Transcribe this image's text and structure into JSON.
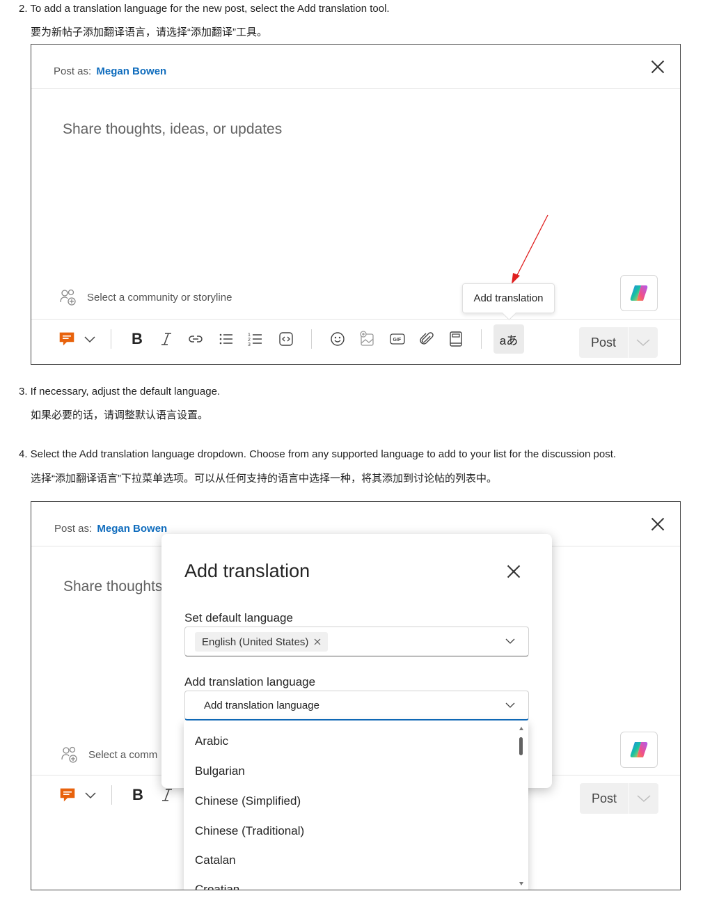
{
  "steps": [
    {
      "en": "2. To add a translation language for the new post, select the Add translation tool.",
      "cn": "要为新帖子添加翻译语言，请选择“添加翻译”工具。"
    },
    {
      "en": "3. If necessary, adjust the default language.",
      "cn": "如果必要的话，请调整默认语言设置。"
    },
    {
      "en": "4. Select the Add translation language dropdown. Choose from any supported language to add to your list for the discussion post.",
      "cn": "选择“添加翻译语言”下拉菜单选项。可以从任何支持的语言中选择一种，将其添加到讨论帖的列表中。"
    }
  ],
  "composer": {
    "post_as_label": "Post as:",
    "post_as_name": "Megan Bowen",
    "placeholder": "Share thoughts, ideas, or updates",
    "placeholder_truncated": "Share thoughts",
    "community_placeholder": "Select a community or storyline",
    "community_truncated": "Select a comm",
    "tooltip": "Add translation",
    "translate_icon_text": "aあ",
    "post_button": "Post",
    "accent_color": "#0f6cbd",
    "icons": [
      "praise-icon",
      "chevron-down-icon",
      "bold-icon",
      "italic-icon",
      "link-icon",
      "bullet-list-icon",
      "numbered-list-icon",
      "code-icon",
      "emoji-icon",
      "image-icon",
      "gif-icon",
      "attach-icon",
      "notebook-icon",
      "translate-icon"
    ]
  },
  "dialog": {
    "title": "Add translation",
    "default_label": "Set default language",
    "default_value": "English (United States)",
    "translation_label": "Add translation language",
    "translation_placeholder": "Add translation language",
    "options": [
      "Arabic",
      "Bulgarian",
      "Chinese (Simplified)",
      "Chinese (Traditional)",
      "Catalan",
      "Croatian"
    ]
  }
}
